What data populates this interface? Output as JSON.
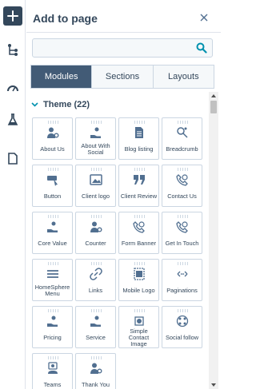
{
  "panel": {
    "title": "Add to page",
    "close_icon": "close-icon"
  },
  "rail": {
    "icons": [
      "plus-icon",
      "tree-icon",
      "gauge-icon",
      "flask-icon",
      "page-icon"
    ]
  },
  "search": {
    "value": "",
    "placeholder": ""
  },
  "tabs": [
    {
      "label": "Modules",
      "active": true
    },
    {
      "label": "Sections",
      "active": false
    },
    {
      "label": "Layouts",
      "active": false
    }
  ],
  "group": {
    "label": "Theme (22)",
    "expanded": true
  },
  "modules": [
    {
      "label": "About Us",
      "icon": "person-gear-icon"
    },
    {
      "label": "About With Social",
      "icon": "hand-coin-icon"
    },
    {
      "label": "Blog listing",
      "icon": "document-icon"
    },
    {
      "label": "Breadcrumb",
      "icon": "breadcrumb-icon"
    },
    {
      "label": "Button",
      "icon": "cursor-button-icon"
    },
    {
      "label": "Client logo",
      "icon": "image-icon"
    },
    {
      "label": "Client Review",
      "icon": "quote-icon"
    },
    {
      "label": "Contact Us",
      "icon": "phone-icon"
    },
    {
      "label": "Core Value",
      "icon": "hand-coin-icon"
    },
    {
      "label": "Counter",
      "icon": "person-gear-icon"
    },
    {
      "label": "Form Banner",
      "icon": "phone-icon"
    },
    {
      "label": "Get In Touch",
      "icon": "phone-icon"
    },
    {
      "label": "HomeSphere Menu",
      "icon": "menu-icon"
    },
    {
      "label": "Links",
      "icon": "link-icon"
    },
    {
      "label": "Mobile Logo",
      "icon": "image-frame-icon"
    },
    {
      "label": "Paginations",
      "icon": "pagination-icon"
    },
    {
      "label": "Pricing",
      "icon": "hand-coin-icon"
    },
    {
      "label": "Service",
      "icon": "hand-coin-icon"
    },
    {
      "label": "Simple Contact Image",
      "icon": "image-stack-icon"
    },
    {
      "label": "Social follow",
      "icon": "social-icon"
    },
    {
      "label": "Teams",
      "icon": "team-icon"
    },
    {
      "label": "Thank You",
      "icon": "person-gear-icon"
    }
  ],
  "colors": {
    "accent": "#425b76",
    "icon": "#516f90",
    "border": "#cbd6e2"
  }
}
